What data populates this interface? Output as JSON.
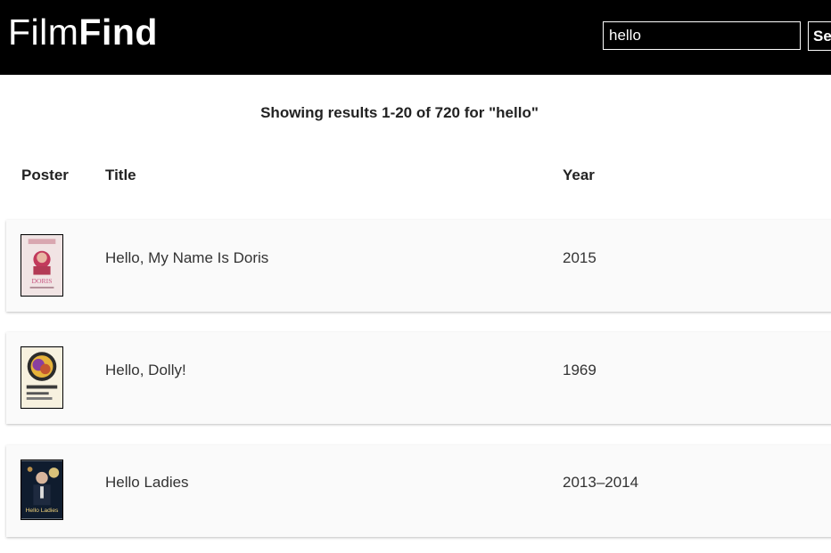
{
  "header": {
    "logo_light": "Film",
    "logo_bold": "Find",
    "search_value": "hello",
    "search_button": "Search"
  },
  "summary": "Showing results 1-20 of 720 for \"hello\"",
  "columns": {
    "poster": "Poster",
    "title": "Title",
    "year": "Year"
  },
  "rows": [
    {
      "title": "Hello, My Name Is Doris",
      "year": "2015",
      "poster_text": "DORIS"
    },
    {
      "title": "Hello, Dolly!",
      "year": "1969",
      "poster_text": ""
    },
    {
      "title": "Hello Ladies",
      "year": "2013–2014",
      "poster_text": "Hello Ladies"
    }
  ]
}
